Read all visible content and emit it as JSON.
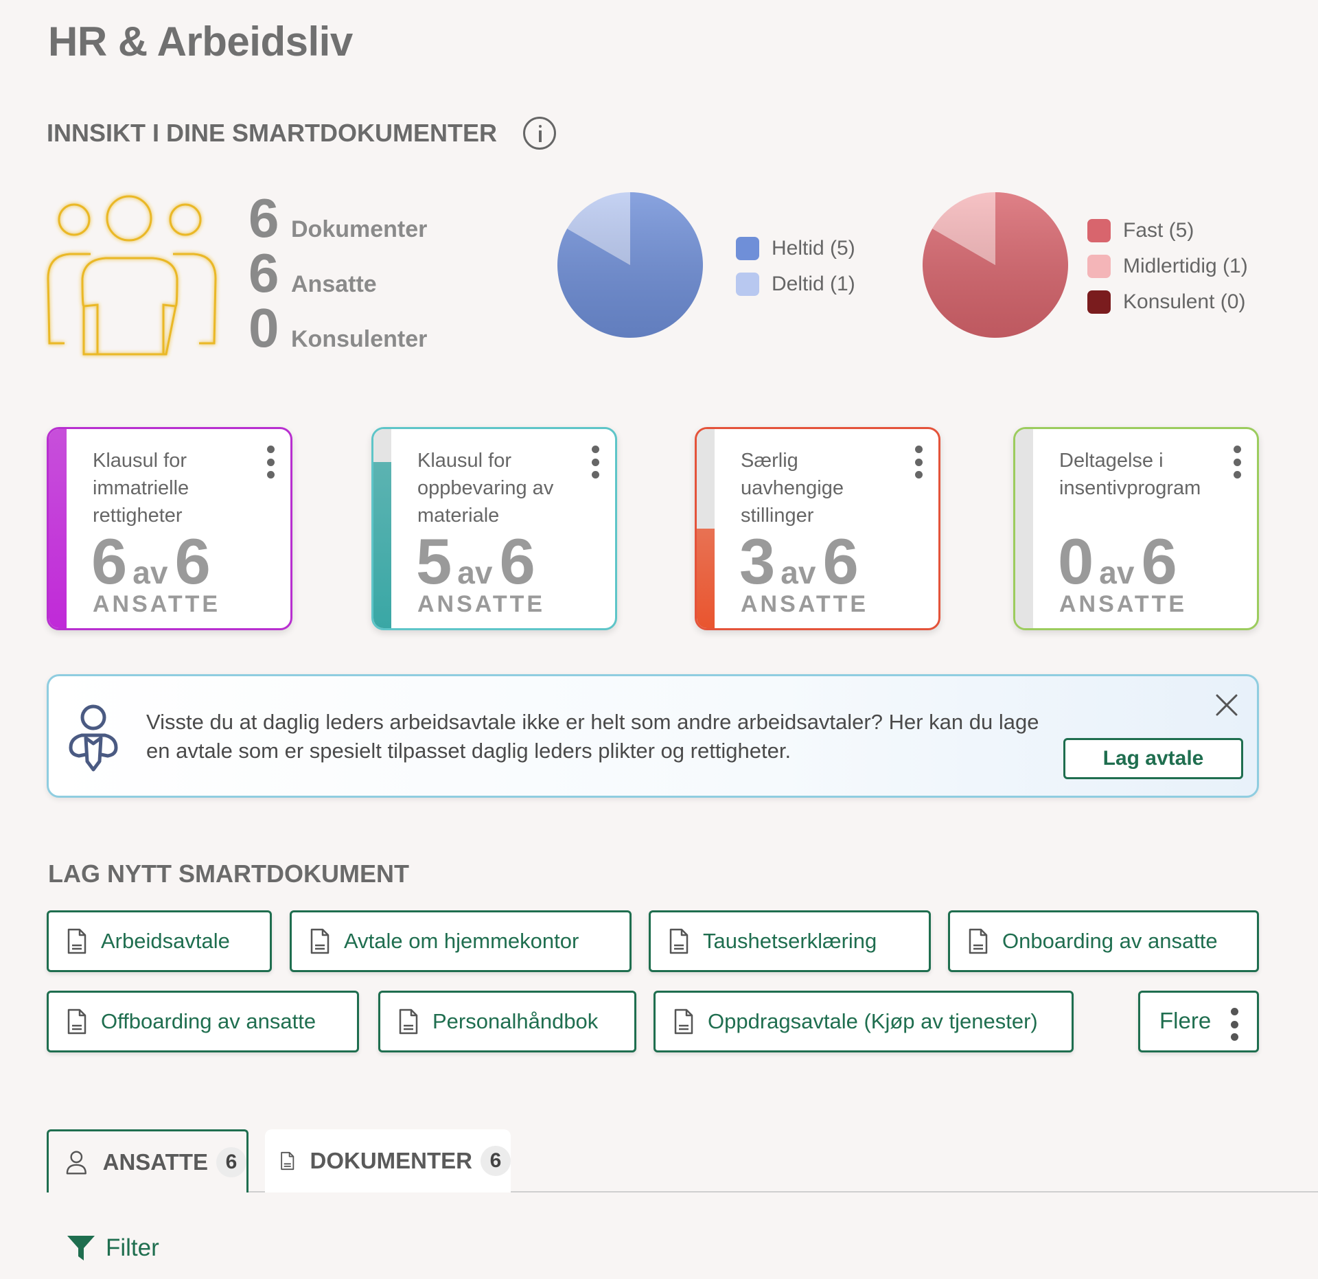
{
  "page_title": "HR & Arbeidsliv",
  "insight": {
    "title": "INNSIKT I DINE SMARTDOKUMENTER",
    "stats": [
      {
        "value": "6",
        "label": "Dokumenter"
      },
      {
        "value": "6",
        "label": "Ansatte"
      },
      {
        "value": "0",
        "label": "Konsulenter"
      }
    ]
  },
  "chart_data": [
    {
      "type": "pie",
      "categories": [
        "Heltid",
        "Deltid"
      ],
      "values": [
        5,
        1
      ],
      "legend": [
        "Heltid (5)",
        "Deltid (1)"
      ],
      "colors": [
        "#6f8fd8",
        "#b8c8f0"
      ],
      "legend_position": "right"
    },
    {
      "type": "pie",
      "categories": [
        "Fast",
        "Midlertidig",
        "Konsulent"
      ],
      "values": [
        5,
        1,
        0
      ],
      "legend": [
        "Fast (5)",
        "Midlertidig (1)",
        "Konsulent (0)"
      ],
      "colors": [
        "#d8656d",
        "#f4b5b8",
        "#7a1c1e"
      ],
      "legend_position": "right"
    }
  ],
  "cards": [
    {
      "title": "Klausul for immatrielle rettigheter",
      "count": "6",
      "of": "av",
      "total": "6",
      "unit": "ANSATTE",
      "fraction": 1.0,
      "color": "#b82fd0",
      "fill": "#c02ad8"
    },
    {
      "title": "Klausul for oppbevaring av materiale",
      "count": "5",
      "of": "av",
      "total": "6",
      "unit": "ANSATTE",
      "fraction": 0.833,
      "color": "#5ec5c8",
      "fill": "#3aa7a5"
    },
    {
      "title": "Særlig uavhengige stillinger",
      "count": "3",
      "of": "av",
      "total": "6",
      "unit": "ANSATTE",
      "fraction": 0.5,
      "color": "#e4533a",
      "fill": "#e9552f"
    },
    {
      "title": "Deltagelse i insentivprogram",
      "count": "0",
      "of": "av",
      "total": "6",
      "unit": "ANSATTE",
      "fraction": 0.0,
      "color": "#9ccc5e",
      "fill": "#9ccc5e"
    }
  ],
  "tip": {
    "text": "Visste du at daglig leders arbeidsavtale ikke er helt som andre arbeidsavtaler? Her kan du lage en avtale som er spesielt tilpasset daglig leders plikter og rettigheter.",
    "button": "Lag avtale"
  },
  "new_doc": {
    "title": "LAG NYTT SMARTDOKUMENT",
    "buttons": [
      "Arbeidsavtale",
      "Avtale om hjemmekontor",
      "Taushetserklæring",
      "Onboarding av ansatte",
      "Offboarding av ansatte",
      "Personalhåndbok",
      "Oppdragsavtale (Kjøp av tjenester)"
    ],
    "more": "Flere"
  },
  "tabs": [
    {
      "label": "ANSATTE",
      "count": "6"
    },
    {
      "label": "DOKUMENTER",
      "count": "6"
    }
  ],
  "filter_label": "Filter",
  "colors": {
    "accent": "#1f6e4f",
    "gold": "#eab825"
  }
}
